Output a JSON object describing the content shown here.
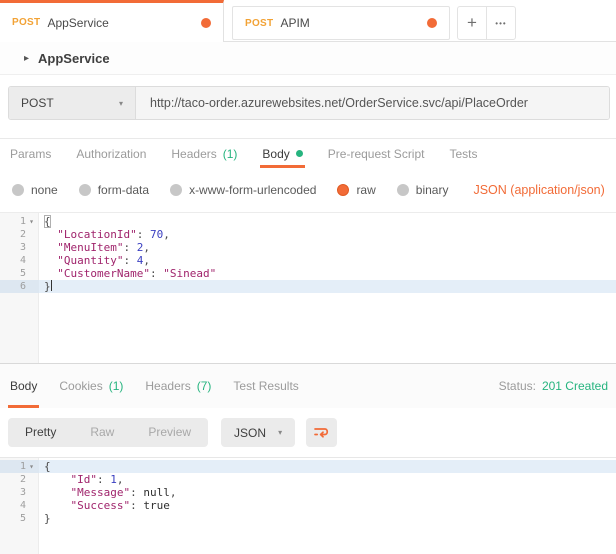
{
  "icons": {
    "caret_down": "▾",
    "disclosure": "▸",
    "plus": "+",
    "more": "•••"
  },
  "colors": {
    "accent": "#F26B37",
    "method_badge": "#F2A235",
    "green": "#26B47F",
    "json_key": "#A0246C",
    "json_number": "#3A3FC1"
  },
  "tabbar": {
    "tabs": [
      {
        "method": "POST",
        "title": "AppService",
        "active": true,
        "unsaved": true
      },
      {
        "method": "POST",
        "title": "APIM",
        "active": false,
        "unsaved": true
      }
    ],
    "new_tab_label": "+",
    "more_label": "•••"
  },
  "request": {
    "name": "AppService",
    "method": "POST",
    "url": "http://taco-order.azurewebsites.net/OrderService.svc/api/PlaceOrder",
    "tabs": [
      {
        "label": "Params"
      },
      {
        "label": "Authorization"
      },
      {
        "label": "Headers",
        "count": "(1)"
      },
      {
        "label": "Body",
        "active": true,
        "dot": true
      },
      {
        "label": "Pre-request Script"
      },
      {
        "label": "Tests"
      }
    ],
    "body_modes": [
      {
        "label": "none"
      },
      {
        "label": "form-data"
      },
      {
        "label": "x-www-form-urlencoded"
      },
      {
        "label": "raw",
        "selected": true
      },
      {
        "label": "binary"
      }
    ],
    "content_type": "JSON (application/json)",
    "editor": {
      "lines": [
        {
          "n": "1",
          "fold": true,
          "tokens": [
            [
              "match",
              "{"
            ]
          ]
        },
        {
          "n": "2",
          "tokens": [
            [
              "plain",
              "  "
            ],
            [
              "str",
              "\"LocationId\""
            ],
            [
              "plain",
              ": "
            ],
            [
              "num",
              "70"
            ],
            [
              "plain",
              ","
            ]
          ]
        },
        {
          "n": "3",
          "tokens": [
            [
              "plain",
              "  "
            ],
            [
              "str",
              "\"MenuItem\""
            ],
            [
              "plain",
              ": "
            ],
            [
              "num",
              "2"
            ],
            [
              "plain",
              ","
            ]
          ]
        },
        {
          "n": "4",
          "tokens": [
            [
              "plain",
              "  "
            ],
            [
              "str",
              "\"Quantity\""
            ],
            [
              "plain",
              ": "
            ],
            [
              "num",
              "4"
            ],
            [
              "plain",
              ","
            ]
          ]
        },
        {
          "n": "5",
          "tokens": [
            [
              "plain",
              "  "
            ],
            [
              "str",
              "\"CustomerName\""
            ],
            [
              "plain",
              ": "
            ],
            [
              "str",
              "\"Sinead\""
            ]
          ]
        },
        {
          "n": "6",
          "hl": true,
          "cursor": true,
          "tokens": [
            [
              "plain",
              "}"
            ]
          ]
        }
      ]
    }
  },
  "response": {
    "tabs": [
      {
        "label": "Body",
        "active": true
      },
      {
        "label": "Cookies",
        "count": "(1)"
      },
      {
        "label": "Headers",
        "count": "(7)"
      },
      {
        "label": "Test Results"
      }
    ],
    "status_label": "Status:",
    "status_value": "201 Created",
    "views": [
      {
        "label": "Pretty",
        "active": true
      },
      {
        "label": "Raw"
      },
      {
        "label": "Preview"
      }
    ],
    "format": "JSON",
    "editor": {
      "lines": [
        {
          "n": "1",
          "fold": true,
          "hl": true,
          "tokens": [
            [
              "plain",
              "{"
            ]
          ]
        },
        {
          "n": "2",
          "tokens": [
            [
              "plain",
              "    "
            ],
            [
              "str",
              "\"Id\""
            ],
            [
              "plain",
              ": "
            ],
            [
              "num",
              "1"
            ],
            [
              "plain",
              ","
            ]
          ]
        },
        {
          "n": "3",
          "tokens": [
            [
              "plain",
              "    "
            ],
            [
              "str",
              "\"Message\""
            ],
            [
              "plain",
              ": "
            ],
            [
              "kw",
              "null"
            ],
            [
              "plain",
              ","
            ]
          ]
        },
        {
          "n": "4",
          "tokens": [
            [
              "plain",
              "    "
            ],
            [
              "str",
              "\"Success\""
            ],
            [
              "plain",
              ": "
            ],
            [
              "kw",
              "true"
            ]
          ]
        },
        {
          "n": "5",
          "tokens": [
            [
              "plain",
              "}"
            ]
          ]
        }
      ]
    }
  }
}
